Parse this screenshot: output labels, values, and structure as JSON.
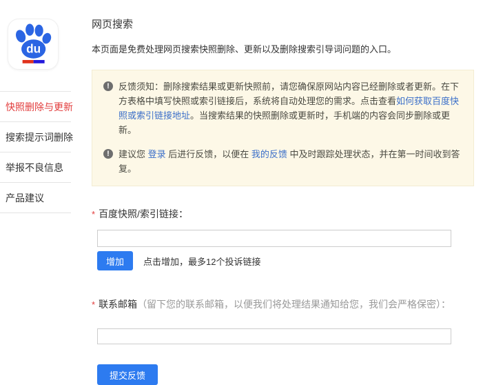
{
  "logo": {
    "du_text": "du"
  },
  "sidebar": {
    "items": [
      {
        "label": "快照删除与更新",
        "active": true
      },
      {
        "label": "搜索提示词删除",
        "active": false
      },
      {
        "label": "举报不良信息",
        "active": false
      },
      {
        "label": "产品建议",
        "active": false
      }
    ]
  },
  "header": {
    "title": "网页搜索",
    "description": "本页面是免费处理网页搜索快照删除、更新以及删除搜索引导词问题的入口。"
  },
  "notice": {
    "p1_prefix": "反馈须知：删除搜索结果或更新快照前，请您确保原网站内容已经删除或者更新。在下方表格中填写快照或索引链接后，系统将自动处理您的需求。点击查看",
    "p1_link": "如何获取百度快照或索引链接地址",
    "p1_suffix": "。当搜索结果的快照删除或更新时，手机端的内容会同步删除或更新。",
    "p2_prefix": "建议您 ",
    "p2_link1": "登录",
    "p2_mid": " 后进行反馈，以便在 ",
    "p2_link2": "我的反馈",
    "p2_suffix": " 中及时跟踪处理状态，并在第一时间收到答复。"
  },
  "form": {
    "required_mark": "*",
    "snapshot_label": "百度快照/索引链接：",
    "snapshot_input_value": "",
    "add_button": "增加",
    "add_hint": "点击增加，最多12个投诉链接",
    "email_label": "联系邮箱",
    "email_label_note": "（留下您的联系邮箱，以便我们将处理结果通知给您，我们会严格保密）：",
    "email_input_value": "",
    "submit_button": "提交反馈"
  },
  "colors": {
    "accent_blue": "#2d7bf0",
    "link_blue": "#3b6fc9",
    "active_red": "#e23c3c",
    "notice_bg": "#fdf8e7",
    "logo_blue": "#2b65e3",
    "logo_bar_red": "#e0321c",
    "logo_bar_blue": "#2319dc"
  }
}
